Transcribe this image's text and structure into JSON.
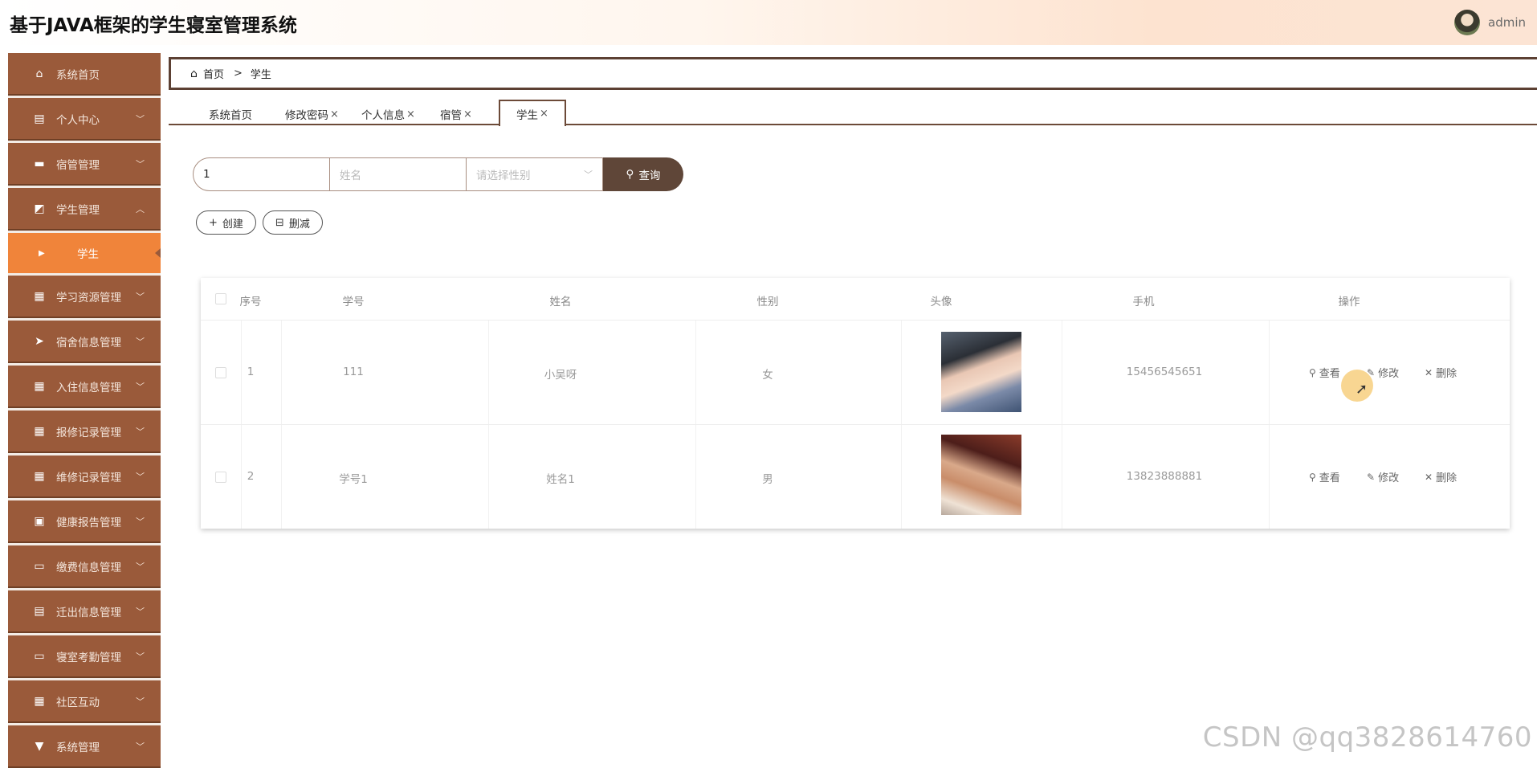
{
  "header": {
    "title": "基于JAVA框架的学生寝室管理系统",
    "user_name": "admin"
  },
  "sidebar": {
    "items": [
      {
        "label": "系统首页",
        "icon": "home-icon",
        "expand": ""
      },
      {
        "label": "个人中心",
        "icon": "id-card-icon",
        "expand": "chevron-down"
      },
      {
        "label": "宿管管理",
        "icon": "briefcase-icon",
        "expand": "chevron-down"
      },
      {
        "label": "学生管理",
        "icon": "chart-icon",
        "expand": "chevron-up"
      },
      {
        "label": "学习资源管理",
        "icon": "grid-icon",
        "expand": "chevron-down"
      },
      {
        "label": "宿舍信息管理",
        "icon": "paper-plane-icon",
        "expand": "chevron-down"
      },
      {
        "label": "入住信息管理",
        "icon": "grid-icon",
        "expand": "chevron-down"
      },
      {
        "label": "报修记录管理",
        "icon": "grid-icon",
        "expand": "chevron-down"
      },
      {
        "label": "维修记录管理",
        "icon": "grid-icon",
        "expand": "chevron-down"
      },
      {
        "label": "健康报告管理",
        "icon": "chat-icon",
        "expand": "chevron-down"
      },
      {
        "label": "缴费信息管理",
        "icon": "monitor-icon",
        "expand": "chevron-down"
      },
      {
        "label": "迁出信息管理",
        "icon": "clipboard-icon",
        "expand": "chevron-down"
      },
      {
        "label": "寝室考勤管理",
        "icon": "monitor-icon",
        "expand": "chevron-down"
      },
      {
        "label": "社区互动",
        "icon": "grid-icon",
        "expand": "chevron-down"
      },
      {
        "label": "系统管理",
        "icon": "pin-icon",
        "expand": "chevron-down"
      }
    ],
    "active_sub": "学生"
  },
  "breadcrumb": {
    "home": "首页",
    "separator": ">",
    "current": "学生"
  },
  "tabs": [
    {
      "label": "系统首页",
      "closable": false
    },
    {
      "label": "修改密码",
      "closable": true
    },
    {
      "label": "个人信息",
      "closable": true
    },
    {
      "label": "宿管",
      "closable": true
    },
    {
      "label": "学生",
      "closable": true,
      "active": true
    }
  ],
  "tab_close_glyph": "×",
  "search": {
    "student_no_value": "1",
    "name_placeholder": "姓名",
    "gender_placeholder": "请选择性别",
    "button_label": "查询"
  },
  "actions": {
    "create_label": "创建",
    "delete_label": "删减"
  },
  "table": {
    "columns": [
      "序号",
      "学号",
      "姓名",
      "性别",
      "头像",
      "手机",
      "操作"
    ],
    "rows": [
      {
        "index": "1",
        "student_no": "111",
        "name": "小吴呀",
        "gender": "女",
        "phone": "15456545651"
      },
      {
        "index": "2",
        "student_no": "学号1",
        "name": "姓名1",
        "gender": "男",
        "phone": "13823888881"
      }
    ],
    "ops": {
      "view": "查看",
      "edit": "修改",
      "delete": "删除"
    }
  },
  "watermark": "CSDN @qq3828614760",
  "colors": {
    "sidebar_bg": "#9a5a3a",
    "sidebar_active": "#f0843a",
    "accent_dark": "#5f4638"
  }
}
